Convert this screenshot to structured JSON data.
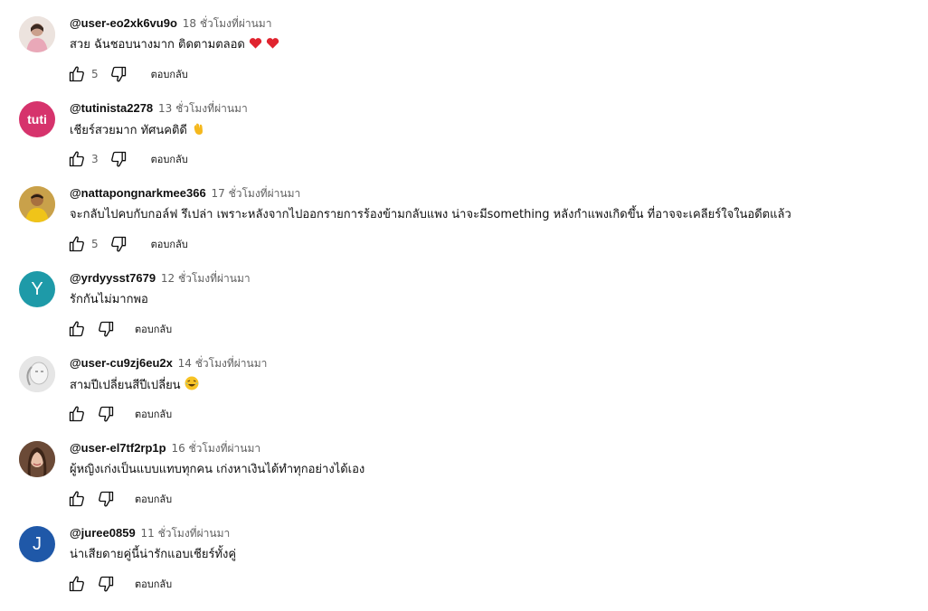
{
  "comments": [
    {
      "author": "@user-eo2xk6vu9o",
      "time": "18 ชั่วโมงที่ผ่านมา",
      "text": "สวย ฉันชอบนางมาก ติดตามตลอด",
      "emoji": "heart-emoji heart-emoji",
      "likes": "5",
      "reply": "ตอบกลับ",
      "avatar": {
        "type": "photo",
        "bg": "#e8d9d2"
      }
    },
    {
      "author": "@tutinista2278",
      "time": "13 ชั่วโมงที่ผ่านมา",
      "text": "เชียร์สวยมาก ทัศนคติดี",
      "emoji": "waving-hand-emoji",
      "likes": "3",
      "reply": "ตอบกลับ",
      "avatar": {
        "type": "logo",
        "text": "tuti",
        "bg": "#d6336c"
      }
    },
    {
      "author": "@nattapongnarkmee366",
      "time": "17 ชั่วโมงที่ผ่านมา",
      "text": "จะกลับไปคบกับกอล์ฟ รึเปล่า เพราะหลังจากไปออกรายการร้องข้ามกลับแพง น่าจะมีsomething หลังกำแพงเกิดขึ้น ที่อาจจะเคลียร์ใจในอดีตแล้ว",
      "likes": "5",
      "reply": "ตอบกลับ",
      "avatar": {
        "type": "photo",
        "bg": "#e0a72a"
      }
    },
    {
      "author": "@yrdyysst7679",
      "time": "12 ชั่วโมงที่ผ่านมา",
      "text": "รักกันไม่มากพอ",
      "likes": "",
      "reply": "ตอบกลับ",
      "avatar": {
        "type": "letter",
        "text": "Y",
        "bg": "#1e9aa8"
      }
    },
    {
      "author": "@user-cu9zj6eu2x",
      "time": "14 ชั่วโมงที่ผ่านมา",
      "text": "สามปีเปลี่ยนสีปีเปลี่ยน",
      "emoji": "laughing-emoji",
      "likes": "",
      "reply": "ตอบกลับ",
      "avatar": {
        "type": "photo",
        "bg": "#d9d9d9"
      }
    },
    {
      "author": "@user-el7tf2rp1p",
      "time": "16 ชั่วโมงที่ผ่านมา",
      "text": "ผู้หญิงเก่งเป็นแบบแทบทุกคน เก่งหาเงินได้ทำทุกอย่างได้เอง",
      "likes": "",
      "reply": "ตอบกลับ",
      "avatar": {
        "type": "photo",
        "bg": "#7a5a48"
      }
    },
    {
      "author": "@juree0859",
      "time": "11 ชั่วโมงที่ผ่านมา",
      "text": "น่าเสียดายคู่นี้น่ารักแอบเชียร์ทั้งคู่",
      "likes": "",
      "reply": "ตอบกลับ",
      "avatar": {
        "type": "letter",
        "text": "J",
        "bg": "#1f58a8"
      }
    }
  ],
  "colors": {
    "text": "#0f0f0f",
    "meta": "#606060"
  }
}
